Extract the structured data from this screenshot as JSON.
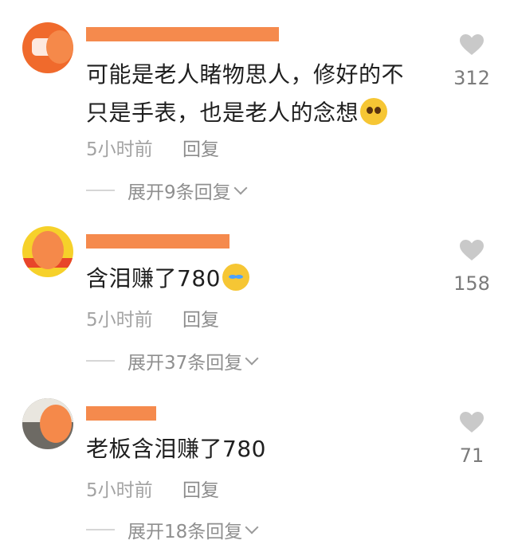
{
  "comments": [
    {
      "text_line1": "可能是老人睹物思人，修好的不",
      "text_line2": "只是手表，也是老人的念想",
      "emoji": "pleading-face-emoji",
      "time": "5小时前",
      "reply_label": "回复",
      "expand_label": "展开9条回复",
      "likes": "312"
    },
    {
      "text_line1": "含泪赚了780",
      "emoji": "laughing-tears-emoji",
      "time": "5小时前",
      "reply_label": "回复",
      "expand_label": "展开37条回复",
      "likes": "158"
    },
    {
      "text_line1": "老板含泪赚了780",
      "time": "5小时前",
      "reply_label": "回复",
      "expand_label": "展开18条回复",
      "likes": "71"
    }
  ],
  "colors": {
    "redaction": "#f5894a",
    "heart": "#c9c9c9"
  }
}
